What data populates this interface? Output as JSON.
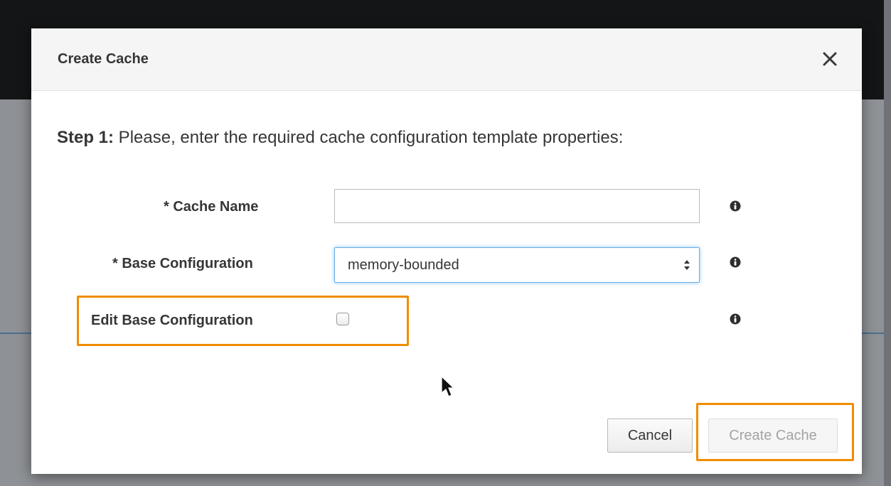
{
  "dialog": {
    "title": "Create Cache",
    "close_icon": "close-icon"
  },
  "step": {
    "label": "Step 1:",
    "text": " Please, enter the required cache configuration template properties:"
  },
  "form": {
    "cache_name": {
      "label": "* Cache Name",
      "value": "",
      "placeholder": ""
    },
    "base_configuration": {
      "label": "* Base Configuration",
      "selected": "memory-bounded"
    },
    "edit_base_configuration": {
      "label": "Edit Base Configuration",
      "checked": false
    },
    "info_icon": "info-icon"
  },
  "buttons": {
    "cancel": "Cancel",
    "create": "Create Cache"
  },
  "colors": {
    "highlight": "#f08c00",
    "focus_border": "#66afe9",
    "disabled_text": "#a3a3a3"
  }
}
